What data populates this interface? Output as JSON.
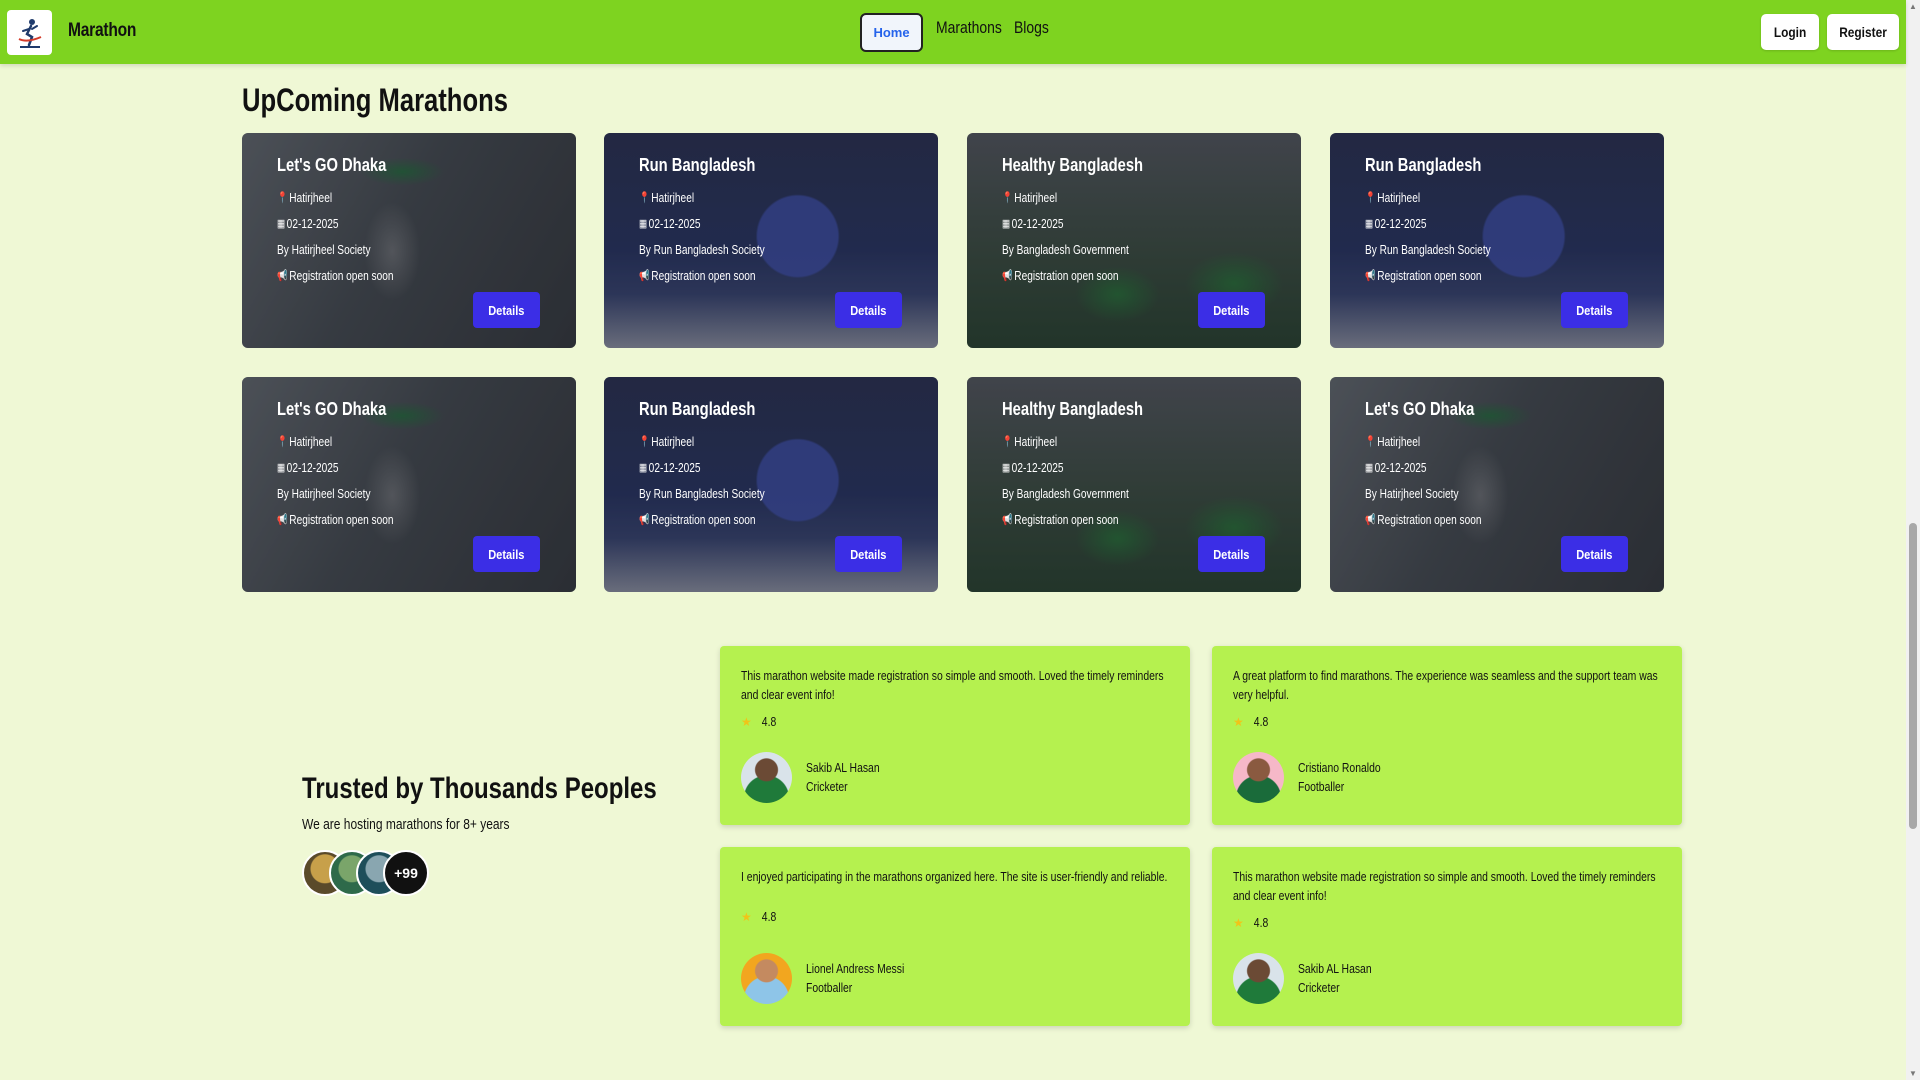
{
  "nav": {
    "brand": "Marathon",
    "links": [
      "Home",
      "Marathons",
      "Blogs"
    ],
    "login": "Login",
    "register": "Register"
  },
  "section_title": "UpComing Marathons",
  "marathons": [
    {
      "title": "Let's GO Dhaka",
      "location": "Hatirjheel",
      "date": "02-12-2025",
      "organizer": "By Hatirjheel Society",
      "status": "Registration open soon",
      "button": "Details",
      "theme": "dhaka"
    },
    {
      "title": "Run Bangladesh",
      "location": "Hatirjheel",
      "date": "02-12-2025",
      "organizer": "By Run Bangladesh Society",
      "status": "Registration open soon",
      "button": "Details",
      "theme": "run"
    },
    {
      "title": "Healthy Bangladesh",
      "location": "Hatirjheel",
      "date": "02-12-2025",
      "organizer": "By Bangladesh Government",
      "status": "Registration open soon",
      "button": "Details",
      "theme": "healthy"
    },
    {
      "title": "Run Bangladesh",
      "location": "Hatirjheel",
      "date": "02-12-2025",
      "organizer": "By Run Bangladesh Society",
      "status": "Registration open soon",
      "button": "Details",
      "theme": "run"
    },
    {
      "title": "Let's GO Dhaka",
      "location": "Hatirjheel",
      "date": "02-12-2025",
      "organizer": "By Hatirjheel Society",
      "status": "Registration open soon",
      "button": "Details",
      "theme": "dhaka"
    },
    {
      "title": "Run Bangladesh",
      "location": "Hatirjheel",
      "date": "02-12-2025",
      "organizer": "By Run Bangladesh Society",
      "status": "Registration open soon",
      "button": "Details",
      "theme": "run"
    },
    {
      "title": "Healthy Bangladesh",
      "location": "Hatirjheel",
      "date": "02-12-2025",
      "organizer": "By Bangladesh Government",
      "status": "Registration open soon",
      "button": "Details",
      "theme": "healthy"
    },
    {
      "title": "Let's GO Dhaka",
      "location": "Hatirjheel",
      "date": "02-12-2025",
      "organizer": "By Hatirjheel Society",
      "status": "Registration open soon",
      "button": "Details",
      "theme": "dhaka"
    }
  ],
  "trusted": {
    "title": "Trusted by Thousands Peoples",
    "subtitle": "We are hosting marathons for 8+ years",
    "more_count": "+99"
  },
  "testimonials": [
    {
      "text": "This marathon website made registration so simple and smooth. Loved the timely reminders and clear event info!",
      "rating": "4.8",
      "name": "Sakib AL Hasan",
      "role": "Cricketer"
    },
    {
      "text": "A great platform to find marathons. The experience was seamless and the support team was very helpful.",
      "rating": "4.8",
      "name": "Cristiano Ronaldo",
      "role": "Footballer"
    },
    {
      "text": "I enjoyed participating in the marathons organized here. The site is user-friendly and reliable.",
      "rating": "4.8",
      "name": "Lionel Andress Messi",
      "role": "Footballer"
    },
    {
      "text": "This marathon website made registration so simple and smooth. Loved the timely reminders and clear event info!",
      "rating": "4.8",
      "name": "Sakib AL Hasan",
      "role": "Cricketer"
    }
  ],
  "colors": {
    "navbar": "#7ed320",
    "page_bg": "#eff8d5",
    "card_button": "#3b2ee6",
    "testimonial_bg": "#b5f14f",
    "star": "#f0c419"
  }
}
